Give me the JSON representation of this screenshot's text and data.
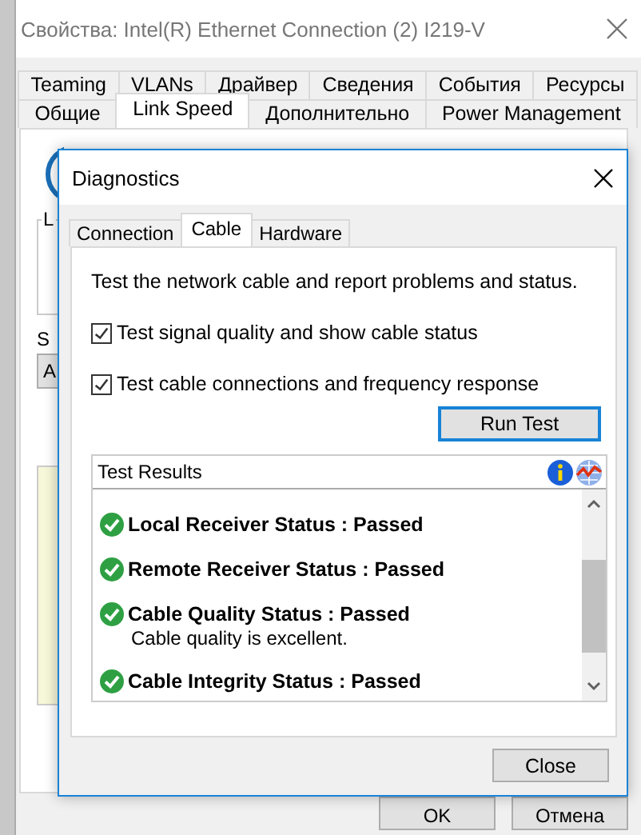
{
  "window": {
    "title": "Свойства: Intel(R) Ethernet Connection (2) I219-V",
    "tab_rows": [
      [
        {
          "label": "Teaming",
          "selected": false
        },
        {
          "label": "VLANs",
          "selected": false
        },
        {
          "label": "Драйвер",
          "selected": false
        },
        {
          "label": "Сведения",
          "selected": false
        },
        {
          "label": "События",
          "selected": false
        },
        {
          "label": "Ресурсы",
          "selected": false
        }
      ],
      [
        {
          "label": "Общие",
          "selected": false
        },
        {
          "label": "Link Speed",
          "selected": true
        },
        {
          "label": "Дополнительно",
          "selected": false
        },
        {
          "label": "Power Management",
          "selected": false
        }
      ]
    ],
    "panel": {
      "group_label": "L",
      "speed_label": "S",
      "speed_value": "A"
    },
    "buttons": [
      "OK",
      "Отмена"
    ]
  },
  "dialog": {
    "title": "Diagnostics",
    "tabs": [
      {
        "label": "Connection",
        "selected": false
      },
      {
        "label": "Cable",
        "selected": true
      },
      {
        "label": "Hardware",
        "selected": false
      }
    ],
    "description": "Test the network cable and report problems and status.",
    "options": [
      {
        "label": "Test signal quality and show cable status",
        "checked": true
      },
      {
        "label": "Test cable connections and frequency response",
        "checked": true
      }
    ],
    "run_button": "Run Test",
    "results": {
      "title": "Test Results",
      "items": [
        {
          "title": "Local Receiver Status : Passed",
          "passed": true
        },
        {
          "title": "Remote Receiver Status : Passed",
          "passed": true
        },
        {
          "title": "Cable Quality Status : Passed",
          "passed": true,
          "detail": "Cable quality is excellent."
        },
        {
          "title": "Cable Integrity Status : Passed",
          "passed": true
        }
      ]
    },
    "close_button": "Close"
  }
}
